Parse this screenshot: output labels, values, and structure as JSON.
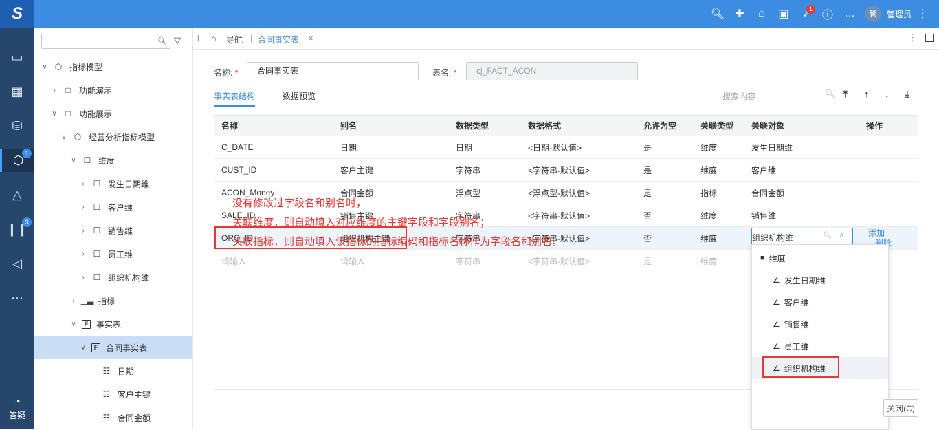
{
  "app": {
    "logo": "S"
  },
  "topbar": {
    "icons": [
      "search-icon",
      "plus-icon",
      "home-icon",
      "bag-icon",
      "bell-icon",
      "help-icon",
      "chat-icon"
    ],
    "bell_badge": "1",
    "avatar_text": "管",
    "username": "管理员"
  },
  "leftnav": {
    "badge_cube": "1",
    "badge_chart": "3",
    "help_label": "答疑"
  },
  "tree": {
    "search_placeholder": "",
    "nodes": [
      {
        "label": "指标模型"
      },
      {
        "label": "功能演示"
      },
      {
        "label": "功能展示"
      },
      {
        "label": "经营分析指标模型"
      },
      {
        "label": "维度"
      },
      {
        "label": "发生日期维"
      },
      {
        "label": "客户维"
      },
      {
        "label": "销售维"
      },
      {
        "label": "员工维"
      },
      {
        "label": "组织机构维"
      },
      {
        "label": "指标"
      },
      {
        "label": "事实表"
      },
      {
        "label": "合同事实表"
      },
      {
        "label": "日期"
      },
      {
        "label": "客户主键"
      },
      {
        "label": "合同金额"
      }
    ]
  },
  "breadcrumb": {
    "nav": "导航",
    "tab": "合同事实表"
  },
  "form": {
    "name_label": "名称:",
    "name_value": "合同事实表",
    "table_label": "表名:",
    "table_value": "cj_FACT_ACON",
    "required_mark": "*"
  },
  "tabs": {
    "structure": "事实表结构",
    "preview": "数据预览"
  },
  "search": {
    "placeholder": "搜索内容"
  },
  "grid": {
    "headers": [
      "名称",
      "别名",
      "数据类型",
      "数据格式",
      "允许为空",
      "关联类型",
      "关联对象",
      "操作"
    ],
    "rows": [
      [
        "C_DATE",
        "日期",
        "日期",
        "<日期-默认值>",
        "是",
        "维度",
        "发生日期维"
      ],
      [
        "CUST_ID",
        "客户主键",
        "字符串",
        "<字符串-默认值>",
        "是",
        "维度",
        "客户维"
      ],
      [
        "ACON_Money",
        "合同金额",
        "浮点型",
        "<浮点型-默认值>",
        "是",
        "指标",
        "合同金额"
      ],
      [
        "SALE_ID",
        "销售主键",
        "字符串",
        "<字符串-默认值>",
        "否",
        "维度",
        "销售维"
      ],
      [
        "ORG_ID",
        "组织机构主键",
        "字符串",
        "<字符串-默认值>",
        "否",
        "维度",
        "组织机构维"
      ],
      [
        "请输入",
        "请输入",
        "字符串",
        "<字符串-默认值>",
        "是",
        "维度",
        ""
      ]
    ],
    "actions": {
      "add": "添加",
      "delete": "删除"
    }
  },
  "note": {
    "line1": "没有修改过字段名和别名时，",
    "line2": "关联维度，则自动填入对应维度的主键字段和字段别名；",
    "line3": "关联指标，则自动填入该指标的指标编码和指标名称作为字段名和别名。"
  },
  "dropdown": {
    "selected_value": "组织机构维",
    "group": "维度",
    "items": [
      "发生日期维",
      "客户维",
      "销售维",
      "员工维",
      "组织机构维"
    ]
  },
  "buttons": {
    "close": "关闭(C)"
  },
  "colors": {
    "accent": "#3c8de2",
    "nav_bg": "#27466b",
    "highlight": "#e53935"
  }
}
